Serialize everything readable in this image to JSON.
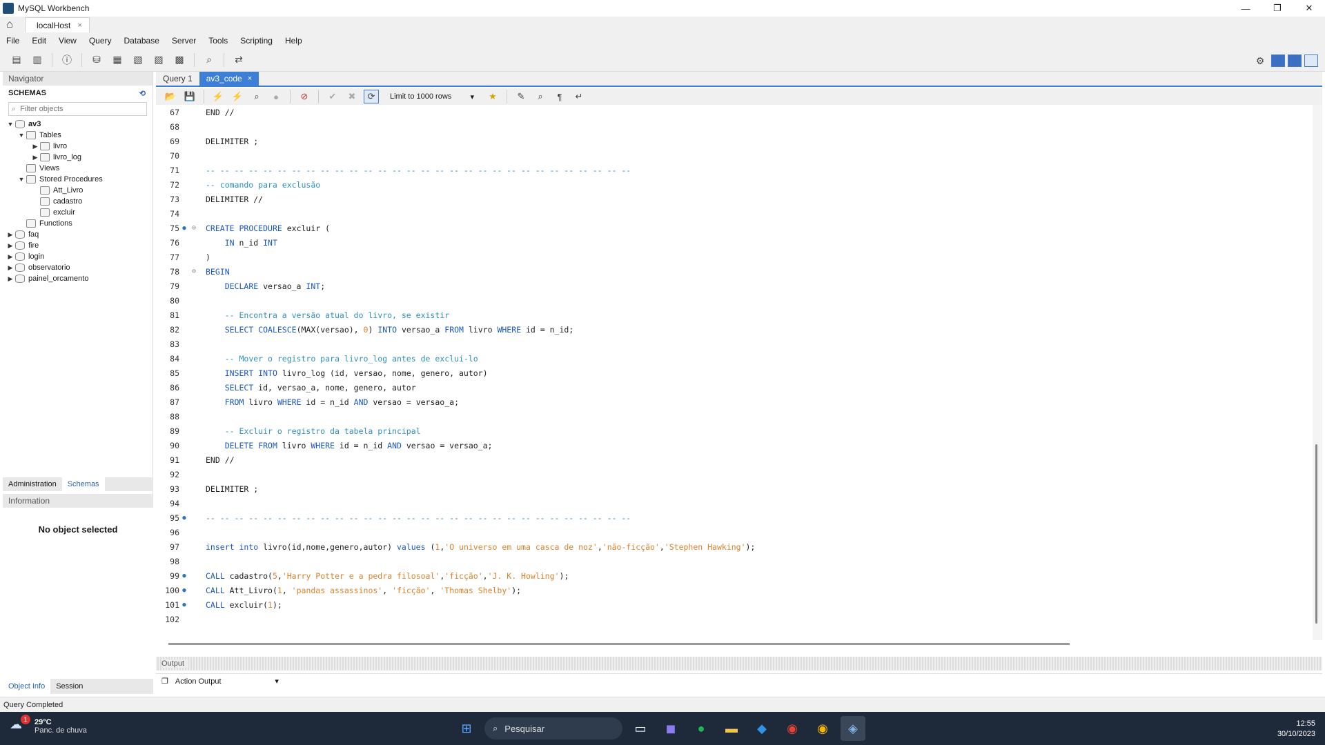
{
  "window": {
    "title": "MySQL Workbench",
    "minimize": "—",
    "restore": "❐",
    "close": "✕"
  },
  "connection_tab": {
    "label": "localHost",
    "close": "×"
  },
  "menu": [
    "File",
    "Edit",
    "View",
    "Query",
    "Database",
    "Server",
    "Tools",
    "Scripting",
    "Help"
  ],
  "navigator": {
    "title": "Navigator",
    "schemas_label": "SCHEMAS",
    "filter_placeholder": "Filter objects",
    "tree": {
      "schema": "av3",
      "tables_label": "Tables",
      "tables": [
        "livro",
        "livro_log"
      ],
      "views_label": "Views",
      "procs_label": "Stored Procedures",
      "procs": [
        "Att_Livro",
        "cadastro",
        "excluir"
      ],
      "functions_label": "Functions",
      "other_schemas": [
        "faq",
        "fire",
        "login",
        "observatorio",
        "painel_orcamento"
      ]
    }
  },
  "nav_tabs": [
    "Administration",
    "Schemas"
  ],
  "information": {
    "title": "Information",
    "message": "No object selected"
  },
  "bottom_tabs": [
    "Object Info",
    "Session"
  ],
  "query_tabs": [
    {
      "label": "Query 1"
    },
    {
      "label": "av3_code",
      "close": "×"
    }
  ],
  "sql_toolbar": {
    "limit": "Limit to 1000 rows"
  },
  "editor": {
    "lines": [
      {
        "n": "67",
        "code": "END //"
      },
      {
        "n": "68",
        "code": ""
      },
      {
        "n": "69",
        "code": "DELIMITER ;"
      },
      {
        "n": "70",
        "code": ""
      },
      {
        "n": "71",
        "code": "-- -- -- -- -- -- -- -- -- -- -- -- -- -- -- -- -- -- -- -- -- -- -- -- -- -- -- -- -- --"
      },
      {
        "n": "72",
        "code": "-- comando para exclusão"
      },
      {
        "n": "73",
        "code": "DELIMITER //"
      },
      {
        "n": "74",
        "code": ""
      },
      {
        "n": "75",
        "code": "CREATE PROCEDURE excluir (",
        "mark": "●",
        "fold": "⊖"
      },
      {
        "n": "76",
        "code": "    IN n_id INT"
      },
      {
        "n": "77",
        "code": ")"
      },
      {
        "n": "78",
        "code": "BEGIN",
        "fold": "⊖"
      },
      {
        "n": "79",
        "code": "    DECLARE versao_a INT;"
      },
      {
        "n": "80",
        "code": ""
      },
      {
        "n": "81",
        "code": "    -- Encontra a versão atual do livro, se existir"
      },
      {
        "n": "82",
        "code": "    SELECT COALESCE(MAX(versao), 0) INTO versao_a FROM livro WHERE id = n_id;"
      },
      {
        "n": "83",
        "code": ""
      },
      {
        "n": "84",
        "code": "    -- Mover o registro para livro_log antes de excluí-lo"
      },
      {
        "n": "85",
        "code": "    INSERT INTO livro_log (id, versao, nome, genero, autor)"
      },
      {
        "n": "86",
        "code": "    SELECT id, versao_a, nome, genero, autor"
      },
      {
        "n": "87",
        "code": "    FROM livro WHERE id = n_id AND versao = versao_a;"
      },
      {
        "n": "88",
        "code": ""
      },
      {
        "n": "89",
        "code": "    -- Excluir o registro da tabela principal"
      },
      {
        "n": "90",
        "code": "    DELETE FROM livro WHERE id = n_id AND versao = versao_a;"
      },
      {
        "n": "91",
        "code": "END //"
      },
      {
        "n": "92",
        "code": ""
      },
      {
        "n": "93",
        "code": "DELIMITER ;"
      },
      {
        "n": "94",
        "code": ""
      },
      {
        "n": "95",
        "code": "-- -- -- -- -- -- -- -- -- -- -- -- -- -- -- -- -- -- -- -- -- -- -- -- -- -- -- -- -- --",
        "mark": "●"
      },
      {
        "n": "96",
        "code": ""
      },
      {
        "n": "97",
        "code": "insert into livro(id,nome,genero,autor) values (1,'O universo em uma casca de noz','não-ficção','Stephen Hawking');"
      },
      {
        "n": "98",
        "code": ""
      },
      {
        "n": "99",
        "code": "CALL cadastro(5,'Harry Potter e a pedra filosoal','ficção','J. K. Howling');",
        "mark": "●"
      },
      {
        "n": "100",
        "code": "CALL Att_Livro(1, 'pandas assassinos', 'ficção', 'Thomas Shelby');",
        "mark": "●"
      },
      {
        "n": "101",
        "code": "CALL excluir(1);",
        "mark": "●"
      },
      {
        "n": "102",
        "code": ""
      }
    ]
  },
  "output": {
    "title": "Output",
    "select": "Action Output"
  },
  "status": "Query Completed",
  "taskbar": {
    "temp": "29°C",
    "weather": "Panc. de chuva",
    "notif_count": "1",
    "search": "Pesquisar",
    "time": "12:55",
    "date": "30/10/2023"
  },
  "colors": {
    "accent": "#3d7fd6",
    "keyword": "#1a56c4",
    "comment": "#2f8fbd",
    "string": "#d9822b",
    "number": "#d9822b"
  }
}
